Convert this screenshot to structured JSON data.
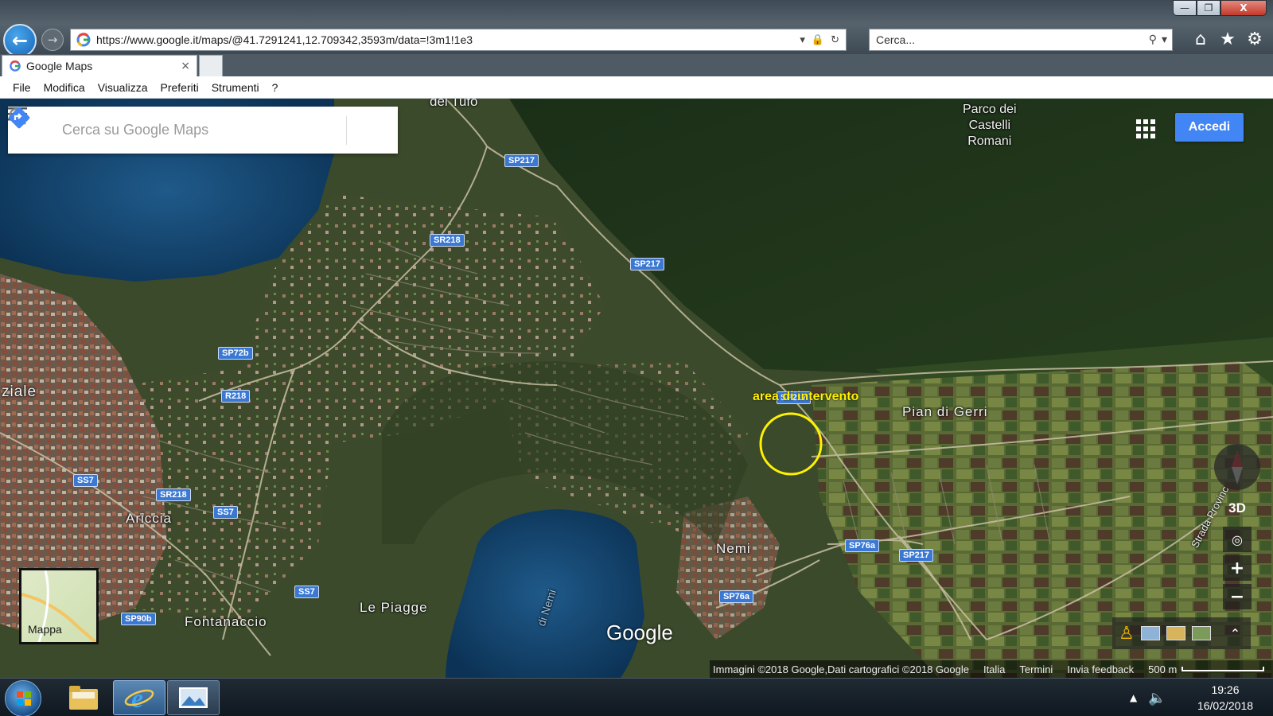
{
  "browser": {
    "address": "https://www.google.it/maps/@41.7291241,12.709342,3593m/data=!3m1!1e3",
    "search_placeholder": "Cerca...",
    "tab_title": "Google Maps",
    "tab_close": "×",
    "menu": [
      "File",
      "Modifica",
      "Visualizza",
      "Preferiti",
      "Strumenti",
      "?"
    ],
    "window_controls": {
      "minimize": "—",
      "restore": "❐",
      "close": "X"
    },
    "icons": {
      "back": "arrow-left-icon",
      "forward": "arrow-right-icon",
      "refresh": "refresh-icon",
      "lock": "lock-icon",
      "home": "home-icon",
      "favorites": "star-icon",
      "settings": "gear-icon"
    }
  },
  "maps": {
    "search_placeholder": "Cerca su Google Maps",
    "signin_label": "Accedi",
    "minimap_label": "Mappa",
    "logo": "Google",
    "controls": {
      "three_d": "3D",
      "zoom_in": "+",
      "zoom_out": "−"
    },
    "attribution": {
      "imagery": "Immagini ©2018 Google,Dati cartografici ©2018 Google",
      "country": "Italia",
      "terms": "Termini",
      "feedback": "Invia feedback",
      "scale": "500 m"
    },
    "annotation": {
      "label": "area di intervento",
      "color": "#fff200"
    },
    "places": {
      "tufo": "del Tufo",
      "parco": [
        "Parco dei",
        "Castelli",
        "Romani"
      ],
      "ziale": "ziale",
      "pian_di_gerri": "Pian di Gerri",
      "ariccia": "Ariccia",
      "nemi": "Nemi",
      "le_piagge": "Le Piagge",
      "fontanaccio": "Fontanaccio",
      "lago_nemi": "di Nemi",
      "strada_prov": "Strada Provinc"
    },
    "road_shields": {
      "sp217_a": "SP217",
      "sp217_b": "SP217",
      "sp217_c": "SP217",
      "sp217_d": "SP217",
      "sr218_a": "SR218",
      "sr218_b": "SR218",
      "r218": "R218",
      "sp72b": "SP72b",
      "ss7_a": "SS7",
      "ss7_b": "SS7",
      "ss7_c": "SS7",
      "sp90b": "SP90b",
      "sp76a_a": "SP76a",
      "sp76a_b": "SP76a"
    }
  },
  "taskbar": {
    "time": "19:26",
    "date": "16/02/2018"
  }
}
